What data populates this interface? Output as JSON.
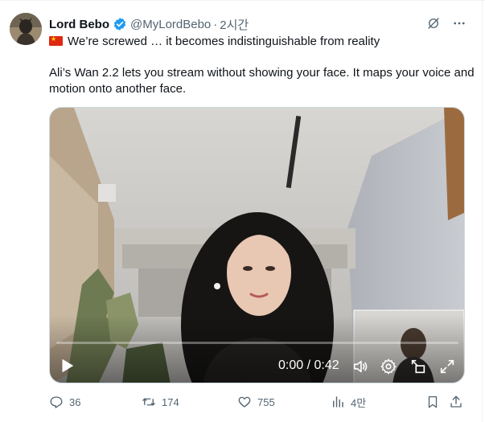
{
  "tweet": {
    "author": {
      "display_name": "Lord Bebo",
      "handle": "@MyLordBebo",
      "verified": true
    },
    "separator": "·",
    "timestamp": "2시간",
    "text_line1": "We’re screwed … it becomes indistinguishable from reality",
    "text_line2": "Ali’s Wan 2.2 lets you stream without showing your face. It maps your voice and motion onto another face.",
    "flag_icon": "china-flag-icon"
  },
  "video": {
    "timecode": "0:00 / 0:42",
    "icons": [
      "play-icon",
      "volume-icon",
      "settings-gear-icon",
      "popout-icon",
      "fullscreen-icon"
    ]
  },
  "actions": {
    "replies": "36",
    "reposts": "174",
    "likes": "755",
    "views": "4만"
  },
  "colors": {
    "text": "#0f1419",
    "secondary": "#536471",
    "verified_blue": "#1d9bf0",
    "border": "#cfd9de"
  }
}
